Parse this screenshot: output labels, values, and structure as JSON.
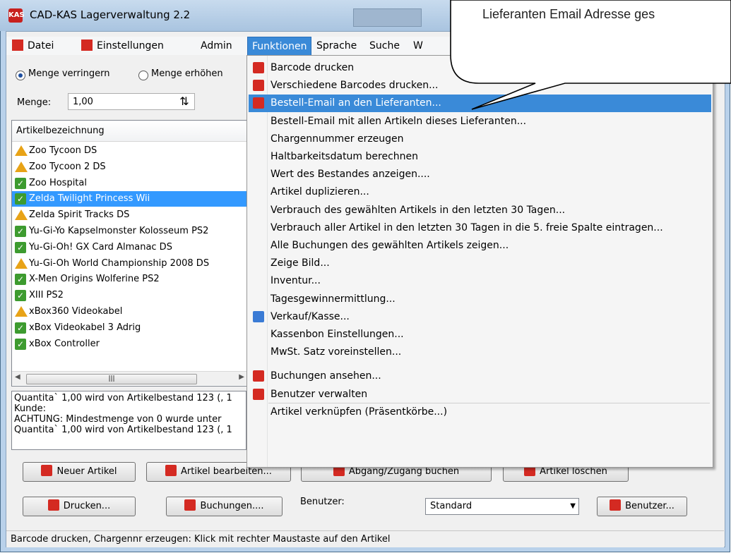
{
  "window": {
    "title": "CAD-KAS Lagerverwaltung 2.2",
    "app_icon_text": "KAS"
  },
  "menubar": {
    "items": [
      "Datei",
      "Einstellungen",
      "Admin",
      "Funktionen",
      "Sprache",
      "Suche",
      "W"
    ],
    "active": "Funktionen"
  },
  "left_panel": {
    "radio_decrease": "Menge verringern",
    "radio_increase": "Menge erhöhen",
    "selected_radio": "Menge verringern",
    "qty_label": "Menge:",
    "qty_value": "1,00",
    "list_header": "Artikelbezeichnung",
    "items": [
      {
        "name": "Zoo Tycoon DS",
        "icon": "warning-icon"
      },
      {
        "name": "Zoo Tycoon 2 DS",
        "icon": "warning-icon"
      },
      {
        "name": "Zoo Hospital",
        "icon": "check-icon"
      },
      {
        "name": "Zelda Twilight Princess Wii",
        "icon": "check-icon",
        "selected": true
      },
      {
        "name": "Zelda Spirit Tracks DS",
        "icon": "warning-icon"
      },
      {
        "name": "Yu-Gi-Yo Kapselmonster Kolosseum PS2",
        "icon": "check-icon"
      },
      {
        "name": "Yu-Gi-Oh! GX Card Almanac DS",
        "icon": "check-icon"
      },
      {
        "name": "Yu-Gi-Oh World Championship 2008 DS",
        "icon": "warning-icon"
      },
      {
        "name": "X-Men Origins Wolferine PS2",
        "icon": "check-icon"
      },
      {
        "name": "XIII PS2",
        "icon": "check-icon"
      },
      {
        "name": "xBox360 Videokabel",
        "icon": "warning-icon"
      },
      {
        "name": "xBox Videokabel 3 Adrig",
        "icon": "check-icon"
      },
      {
        "name": "xBox Controller",
        "icon": "check-icon"
      }
    ],
    "log_lines": [
      "Quantita` 1,00 wird von Artikelbestand 123 (, 1",
      "Kunde:",
      "ACHTUNG: Mindestmenge von 0 wurde unter",
      "Quantita` 1,00 wird von Artikelbestand 123 (, 1"
    ]
  },
  "buttons": {
    "new_article": "Neuer Artikel",
    "edit_article": "Artikel bearbeiten...",
    "book": "Abgang/Zugang buchen",
    "delete_article": "Artikel löschen",
    "print": "Drucken...",
    "bookings": "Buchungen....",
    "user_label": "Benutzer:",
    "user_value": "Standard",
    "users_button": "Benutzer..."
  },
  "dropdown": {
    "items": [
      {
        "label": "Barcode drucken",
        "icon": "printer-icon"
      },
      {
        "label": "Verschiedene Barcodes drucken...",
        "icon": "printer-icon"
      },
      {
        "label": "Bestell-Email an den Lieferanten...",
        "icon": "email-icon",
        "highlighted": true
      },
      {
        "label": "Bestell-Email mit allen Artikeln dieses Lieferanten..."
      },
      {
        "label": "Chargennummer erzeugen"
      },
      {
        "label": "Haltbarkeitsdatum berechnen"
      },
      {
        "label": "Wert des Bestandes anzeigen...."
      },
      {
        "label": "Artikel duplizieren..."
      },
      {
        "label": "Verbrauch des gewählten Artikels in den letzten 30 Tagen..."
      },
      {
        "label": "Verbrauch aller Artikel in den letzten 30 Tagen in die 5. freie Spalte eintragen..."
      },
      {
        "label": "Alle Buchungen des gewählten Artikels zeigen..."
      },
      {
        "label": "Zeige Bild..."
      },
      {
        "label": "Inventur..."
      },
      {
        "label": "Tagesgewinnermittlung..."
      },
      {
        "label": "Verkauf/Kasse...",
        "icon": "cash-register-icon"
      },
      {
        "label": "Kassenbon Einstellungen..."
      },
      {
        "label": "MwSt. Satz voreinstellen..."
      },
      {
        "label": "Buchungen ansehen...",
        "icon": "bookings-icon"
      },
      {
        "label": "Benutzer verwalten",
        "icon": "users-icon"
      },
      {
        "label": "Artikel verknüpfen (Präsentkörbe...)"
      }
    ]
  },
  "statusbar": {
    "text": "Barcode drucken, Chargennr erzeugen: Klick mit rechter Maustaste auf den Artikel"
  },
  "callout": {
    "text": "Lieferanten Email Adresse ges"
  },
  "colors": {
    "menu_highlight": "#3a8ad8",
    "list_selection": "#3399ff",
    "warning": "#e8a317",
    "ok": "#3d9b2f",
    "accent_red": "#d42a22"
  }
}
